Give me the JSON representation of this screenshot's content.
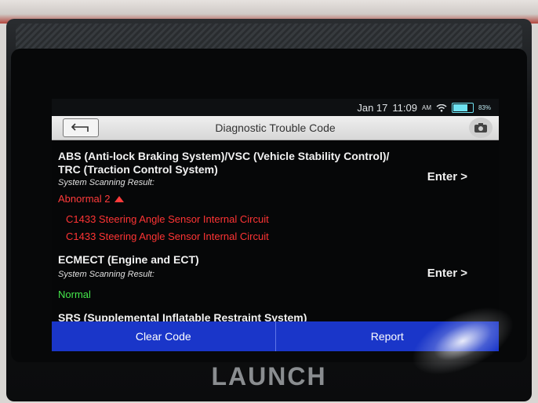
{
  "status_bar": {
    "date": "Jan 17",
    "time": "11:09",
    "ampm": "AM",
    "battery": "83%",
    "battery_level": 0.83
  },
  "header": {
    "title": "Diagnostic Trouble Code",
    "back_icon": "back-arrow-icon",
    "camera_icon": "camera-icon"
  },
  "systems": [
    {
      "name_line1": "ABS (Anti-lock Braking System)/VSC (Vehicle Stability Control)/",
      "name_line2": "TRC (Traction Control System)",
      "scan_label": "System Scanning Result:",
      "result": "Abnormal 2",
      "enter": "Enter >",
      "codes": [
        "C1433 Steering Angle Sensor Internal Circuit",
        "C1433 Steering Angle Sensor Internal Circuit"
      ]
    },
    {
      "name": "ECMECT (Engine and ECT)",
      "scan_label": "System Scanning Result:",
      "result": "Normal",
      "enter": "Enter >"
    },
    {
      "name": "SRS (Supplemental Inflatable Restraint System)"
    }
  ],
  "actions": {
    "clear": "Clear Code",
    "report": "Report"
  },
  "device": {
    "brand": "LAUNCH"
  },
  "colors": {
    "error": "#ff3434",
    "ok": "#45e64b",
    "action_bar": "#1a36c9",
    "battery": "#6ee2f1"
  }
}
